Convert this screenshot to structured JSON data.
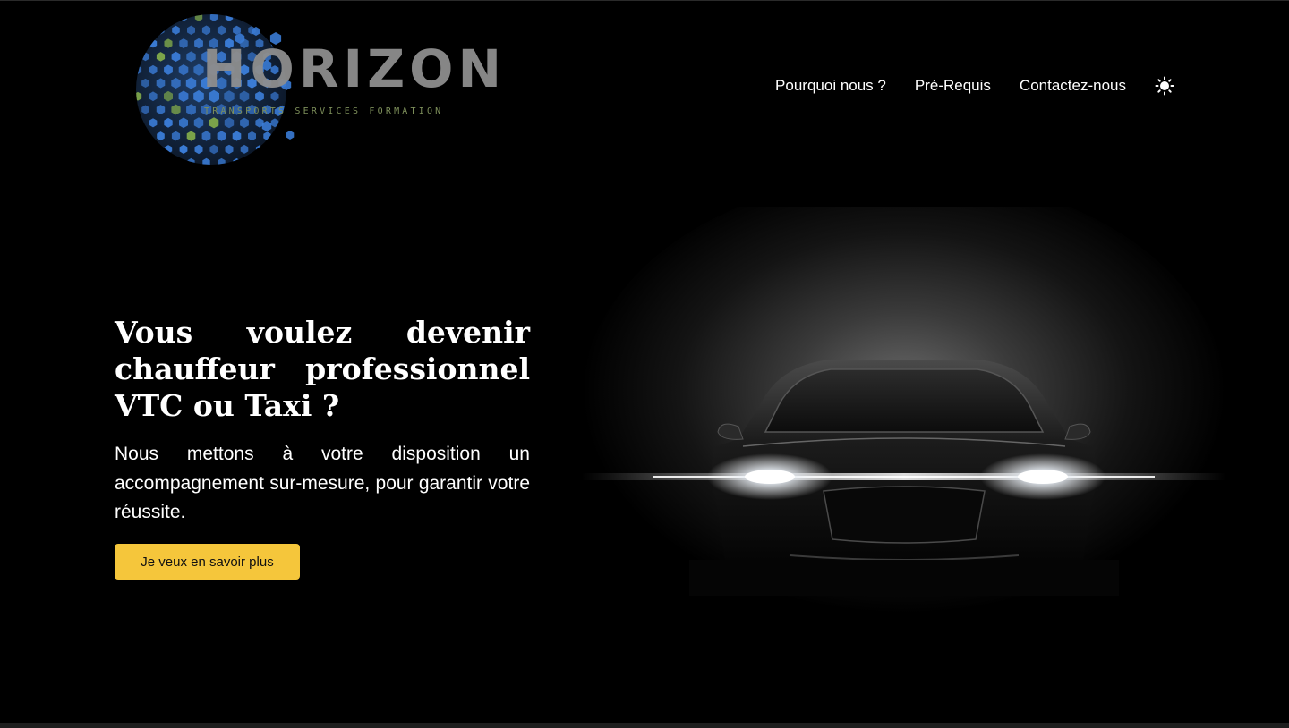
{
  "logo": {
    "wordmark": "HORIZON",
    "tagline": "TRANSPORTS SERVICES FORMATION"
  },
  "nav": {
    "items": [
      {
        "label": "Pourquoi nous ?"
      },
      {
        "label": "Pré-Requis"
      },
      {
        "label": "Contactez-nous"
      }
    ],
    "theme_toggle_icon": "sun-icon"
  },
  "hero": {
    "title": "Vous voulez devenir chauffeur professionnel VTC ou Taxi ?",
    "subtitle": "Nous mettons à votre disposition un accompagnement sur-mesure, pour garantir votre réussite.",
    "cta_label": "Je veux en savoir plus",
    "image_icon": "car-headlights-image"
  },
  "colors": {
    "background": "#000000",
    "accent": "#f5c63b",
    "logo_blue": "#3a7bd5",
    "logo_green": "#7fa84a"
  }
}
